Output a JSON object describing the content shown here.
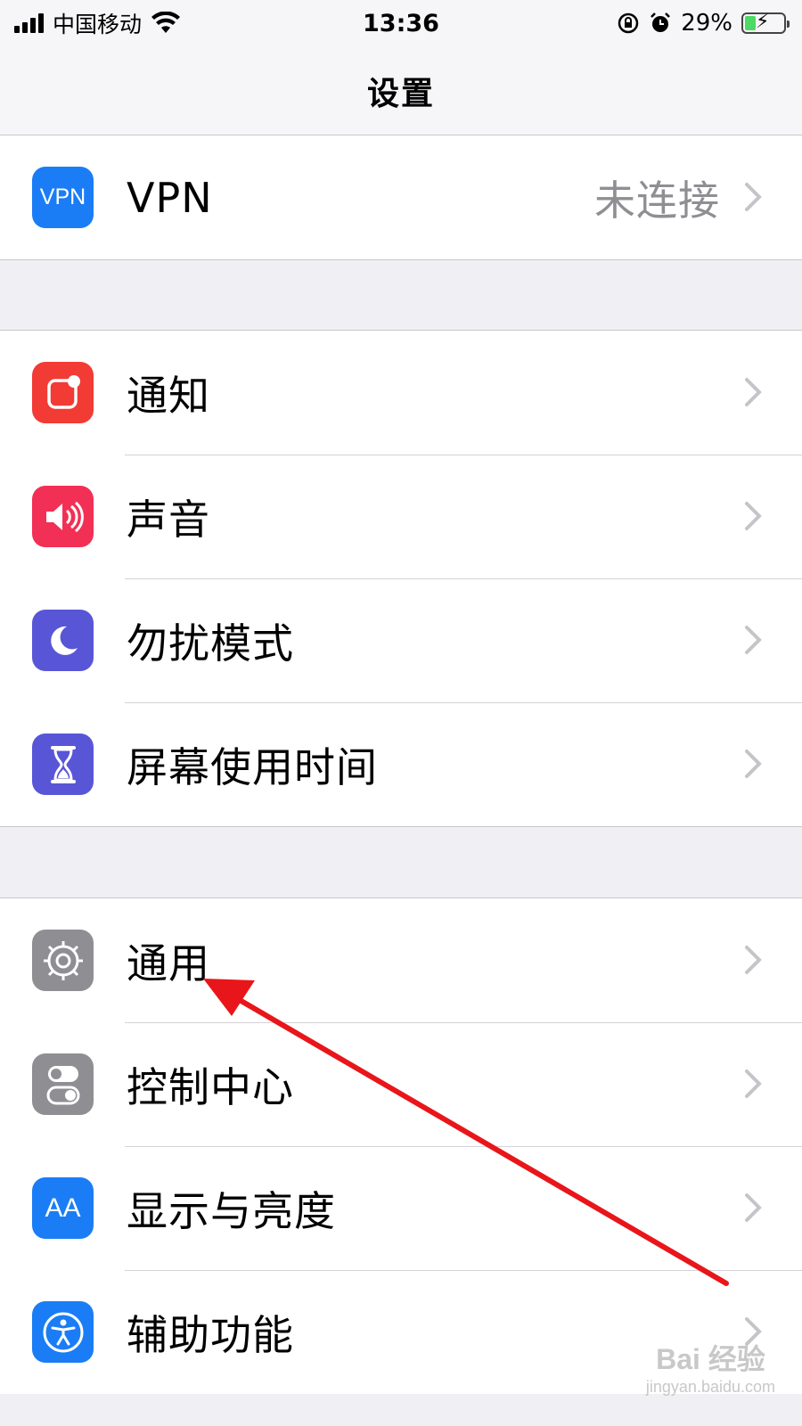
{
  "status_bar": {
    "carrier": "中国移动",
    "time": "13:36",
    "battery_percent": "29%",
    "battery_level": 0.29
  },
  "nav": {
    "title": "设置"
  },
  "groups": [
    {
      "rows": [
        {
          "label": "VPN",
          "detail": "未连接",
          "icon": "vpn-icon",
          "icon_color": "#1a7df6",
          "icon_text": "VPN"
        }
      ]
    },
    {
      "rows": [
        {
          "label": "通知",
          "icon": "notifications-icon",
          "icon_color": "#f23b34"
        },
        {
          "label": "声音",
          "icon": "sound-icon",
          "icon_color": "#f22f55"
        },
        {
          "label": "勿扰模式",
          "icon": "moon-icon",
          "icon_color": "#5856d6"
        },
        {
          "label": "屏幕使用时间",
          "icon": "hourglass-icon",
          "icon_color": "#5856d6"
        }
      ]
    },
    {
      "rows": [
        {
          "label": "通用",
          "icon": "gear-icon",
          "icon_color": "#8e8e93"
        },
        {
          "label": "控制中心",
          "icon": "switches-icon",
          "icon_color": "#8e8e93"
        },
        {
          "label": "显示与亮度",
          "icon": "display-icon",
          "icon_color": "#1a7df6",
          "icon_text": "AA"
        },
        {
          "label": "辅助功能",
          "icon": "accessibility-icon",
          "icon_color": "#1a7df6"
        }
      ]
    }
  ],
  "annotation": {
    "color": "#e8161a"
  },
  "watermark": {
    "main": "Bai 经验",
    "sub": "jingyan.baidu.com"
  }
}
